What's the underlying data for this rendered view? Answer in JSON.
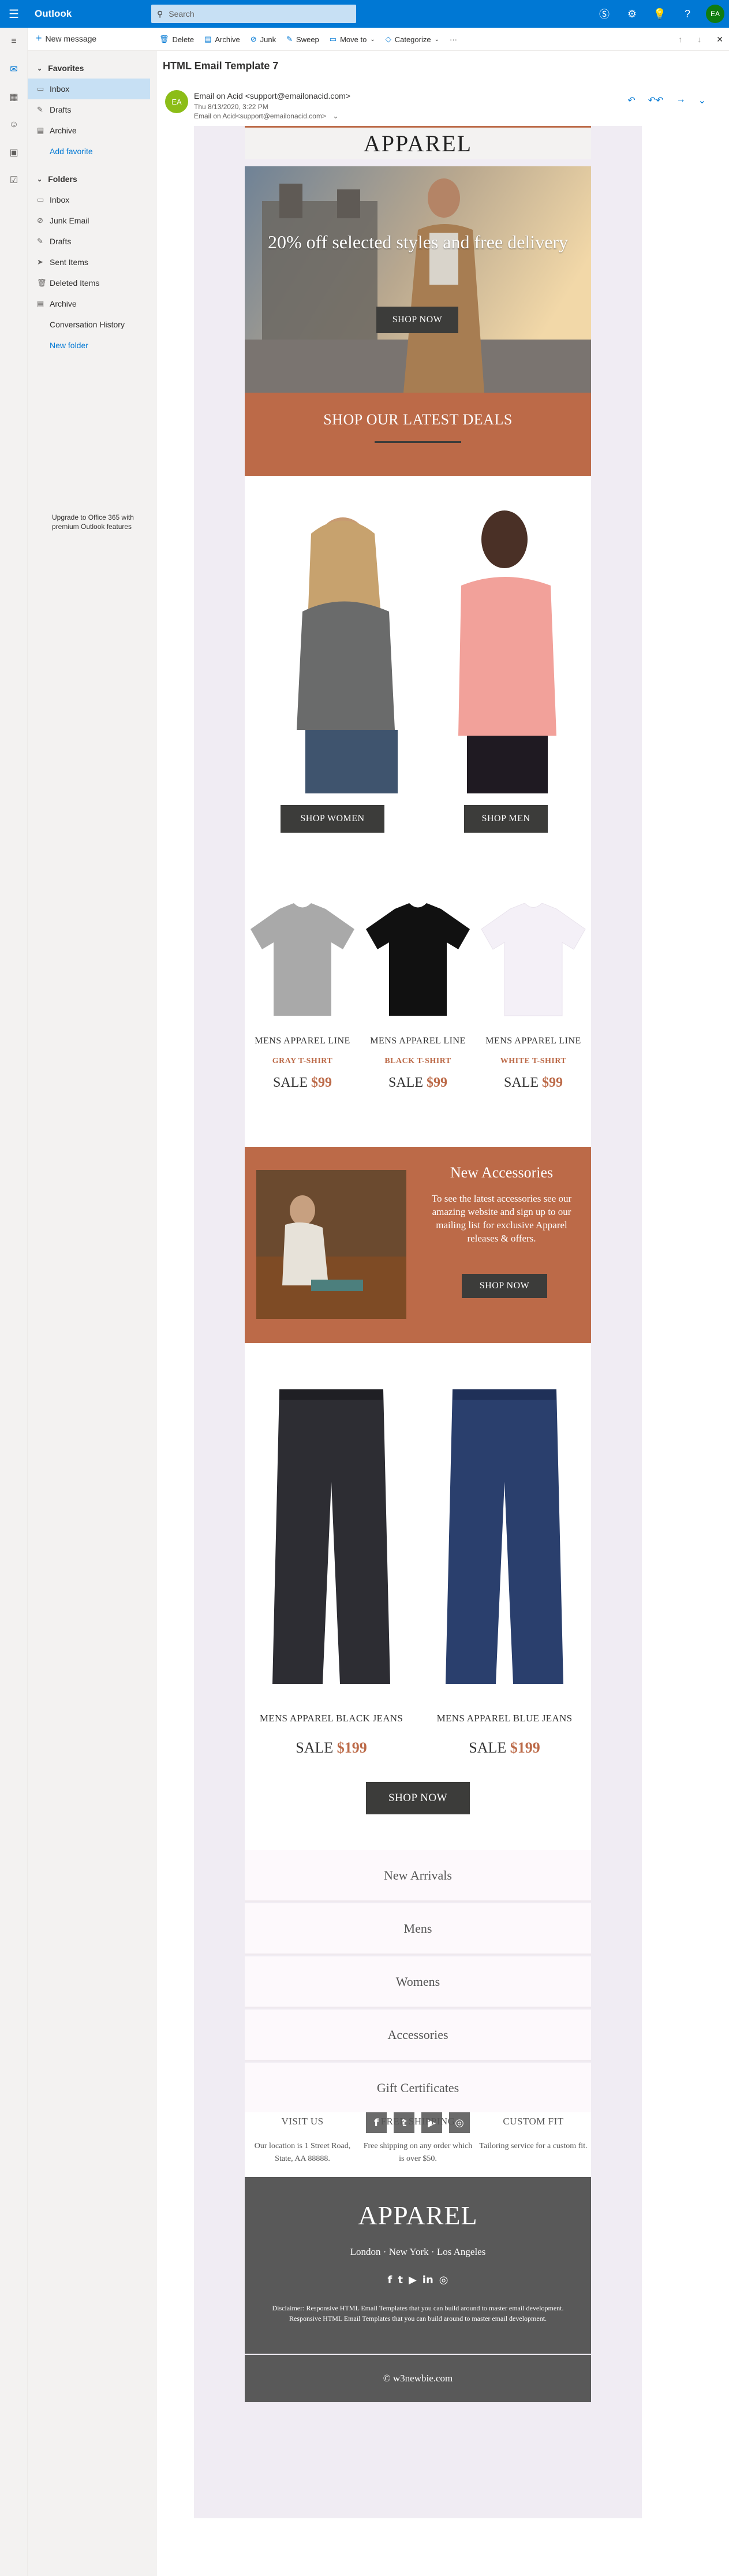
{
  "app": {
    "name": "Outlook",
    "search_placeholder": "Search",
    "user_initials": "EA"
  },
  "commands": {
    "new_message": "New message",
    "delete": "Delete",
    "archive": "Archive",
    "junk": "Junk",
    "sweep": "Sweep",
    "move_to": "Move to",
    "categorize": "Categorize"
  },
  "folders": {
    "favorites_label": "Favorites",
    "favorites": [
      "Inbox",
      "Drafts",
      "Archive"
    ],
    "add_favorite": "Add favorite",
    "folders_label": "Folders",
    "items": [
      "Inbox",
      "Junk Email",
      "Drafts",
      "Sent Items",
      "Deleted Items",
      "Archive"
    ],
    "conversation_history": "Conversation History",
    "new_folder": "New folder",
    "upgrade": "Upgrade to Office 365 with premium Outlook features"
  },
  "message": {
    "subject": "HTML Email Template 7",
    "sender_initials": "EA",
    "sender": "Email on Acid <support@emailonacid.com>",
    "date": "Thu 8/13/2020, 3:22 PM",
    "to": "Email on Acid<support@emailonacid.com>"
  },
  "email": {
    "brand": "APPAREL",
    "hero_text": "20% off selected styles and free delivery",
    "hero_button": "SHOP NOW",
    "deals_title": "SHOP OUR LATEST DEALS",
    "shop_women": "SHOP WOMEN",
    "shop_men": "SHOP MEN",
    "tshirts": [
      {
        "line": "MENS APPAREL LINE",
        "color": "GRAY T-SHIRT",
        "sale": "SALE",
        "price": "$99"
      },
      {
        "line": "MENS APPAREL LINE",
        "color": "BLACK T-SHIRT",
        "sale": "SALE",
        "price": "$99"
      },
      {
        "line": "MENS APPAREL LINE",
        "color": "WHITE T-SHIRT",
        "sale": "SALE",
        "price": "$99"
      }
    ],
    "accessories": {
      "title": "New Accessories",
      "body": "To see the latest accessories see our amazing website and sign up to our mailing list for exclusive Apparel releases & offers.",
      "button": "SHOP NOW"
    },
    "jeans": [
      {
        "name": "MENS APPAREL BLACK JEANS",
        "sale": "SALE",
        "price": "$199"
      },
      {
        "name": "MENS APPAREL BLUE JEANS",
        "sale": "SALE",
        "price": "$199"
      }
    ],
    "jeans_button": "SHOP NOW",
    "nav": [
      "New Arrivals",
      "Mens",
      "Womens",
      "Accessories",
      "Gift Certificates"
    ],
    "social_icons": [
      "facebook-icon",
      "twitter-icon",
      "youtube-icon",
      "instagram-icon"
    ],
    "info": [
      {
        "heading": "VISIT US",
        "text": "Our location is 1 Street Road, State, AA 88888."
      },
      {
        "heading": "FREE SHIPPING",
        "text": "Free shipping on any order which is over $50."
      },
      {
        "heading": "CUSTOM FIT",
        "text": "Tailoring service for a custom fit."
      }
    ],
    "footer_brand": "APPAREL",
    "footer_cities": "London · New York · Los Angeles",
    "disclaimer": "Disclaimer: Responsive HTML Email Templates that you can build around to master email development. Responsive HTML Email Templates that you can build around to master email development.",
    "copyright": "© w3newbie.com"
  },
  "colors": {
    "accent": "#0078d4",
    "brand_orange": "#bc6a48",
    "button_dark": "#3c3c3a",
    "footer_gray": "#595959"
  }
}
